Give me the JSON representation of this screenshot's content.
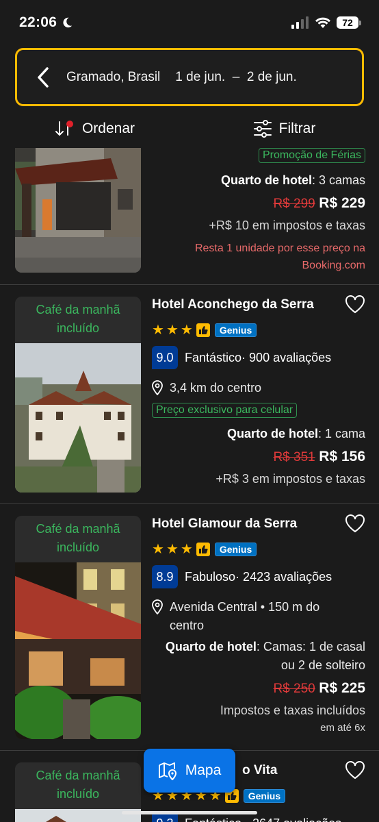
{
  "status": {
    "time": "22:06",
    "battery": "72"
  },
  "search": {
    "destination": "Gramado, Brasil",
    "dates": "1 de jun.  –  2 de jun."
  },
  "toolbar": {
    "sort_label": "Ordenar",
    "filter_label": "Filtrar"
  },
  "icons": {
    "back": "chevron-left-icon",
    "sort": "sort-arrows-icon",
    "filter": "sliders-icon",
    "heart": "heart-outline-icon",
    "location": "location-pin-icon",
    "map": "map-pin-icon",
    "moon": "moon-icon"
  },
  "colors": {
    "accent": "#febb02",
    "genius": "#0071c2",
    "score": "#003b95",
    "breakfast": "#3bb75e",
    "old_price": "#e03a3a",
    "map_button": "#0a73e6"
  },
  "hotels": [
    {
      "promo": "Promoção de Férias",
      "room_label": "Quarto de hotel",
      "room_detail": ": 3 camas",
      "old_price": "R$ 299",
      "price": "R$ 229",
      "taxes": "+R$ 10 em impostos e taxas",
      "warning": "Resta 1 unidade por esse preço na Booking.com"
    },
    {
      "breakfast": "Café da manhã incluído",
      "name": "Hotel Aconchego da Serra",
      "stars": 3,
      "genius": "Genius",
      "score": "9.0",
      "score_label": "Fantástico",
      "reviews": " · 900 avaliações",
      "distance": "3,4 km do centro",
      "promo": "Preço exclusivo para celular",
      "room_label": "Quarto de hotel",
      "room_detail": ": 1 cama",
      "old_price": "R$ 351",
      "price": "R$ 156",
      "taxes": "+R$ 3 em impostos e taxas"
    },
    {
      "breakfast": "Café da manhã incluído",
      "name": "Hotel Glamour da Serra",
      "stars": 3,
      "genius": "Genius",
      "score": "8.9",
      "score_label": "Fabuloso",
      "reviews": " · 2423 avaliações",
      "distance": "Avenida Central • 150 m do centro",
      "room_label": "Quarto de hotel",
      "room_detail": ": Camas: 1 de casal ou 2 de solteiro",
      "old_price": "R$ 250",
      "price": "R$ 225",
      "taxes": "Impostos e taxas incluídos",
      "installments": "em até 6x"
    },
    {
      "breakfast": "Café da manhã incluído",
      "name_visible": "o Vita",
      "stars": 5,
      "genius": "Genius",
      "score_partial": "9.3",
      "reviews_partial": "Fantástico · 2647 avaliações"
    }
  ],
  "map_button": {
    "label": "Mapa"
  }
}
